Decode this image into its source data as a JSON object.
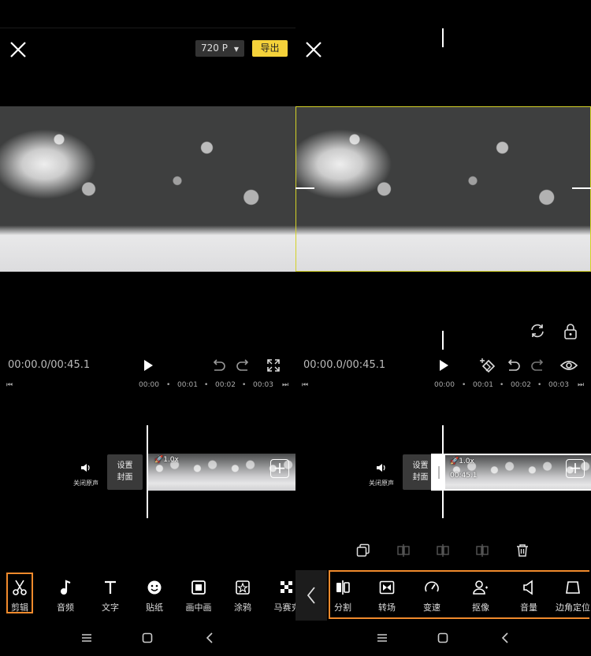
{
  "left": {
    "resolution": "720 P",
    "export_label": "导出",
    "timecode": "00:00.0/00:45.1",
    "ruler_ticks": [
      "00:00",
      "00:01",
      "00:02",
      "00:03"
    ],
    "mute_label": "关闭原声",
    "cover_line1": "设置",
    "cover_line2": "封面",
    "speed": "1.0x",
    "tools": [
      {
        "label": "剪辑",
        "icon": "scissors-icon"
      },
      {
        "label": "音频",
        "icon": "music-note-icon"
      },
      {
        "label": "文字",
        "icon": "text-icon"
      },
      {
        "label": "贴纸",
        "icon": "sticker-icon"
      },
      {
        "label": "画中画",
        "icon": "pip-icon"
      },
      {
        "label": "涂鸦",
        "icon": "doodle-icon"
      },
      {
        "label": "马赛克",
        "icon": "mosaic-icon"
      }
    ]
  },
  "right": {
    "timecode": "00:00.0/00:45.1",
    "ruler_ticks": [
      "00:00",
      "00:01",
      "00:02",
      "00:03"
    ],
    "mute_label": "关闭原声",
    "cover_line1": "设置",
    "cover_line2": "封面",
    "speed": "1.0x",
    "clip_duration": "00:45.1",
    "tools": [
      {
        "label": "分割",
        "icon": "split-icon"
      },
      {
        "label": "转场",
        "icon": "transition-icon"
      },
      {
        "label": "变速",
        "icon": "speed-icon"
      },
      {
        "label": "抠像",
        "icon": "cutout-icon"
      },
      {
        "label": "音量",
        "icon": "volume-icon"
      },
      {
        "label": "边角定位",
        "icon": "corner-pin-icon"
      }
    ]
  },
  "colors": {
    "accent_yellow": "#f5d23a",
    "highlight_orange": "#f08a2c",
    "background": "#000000"
  }
}
